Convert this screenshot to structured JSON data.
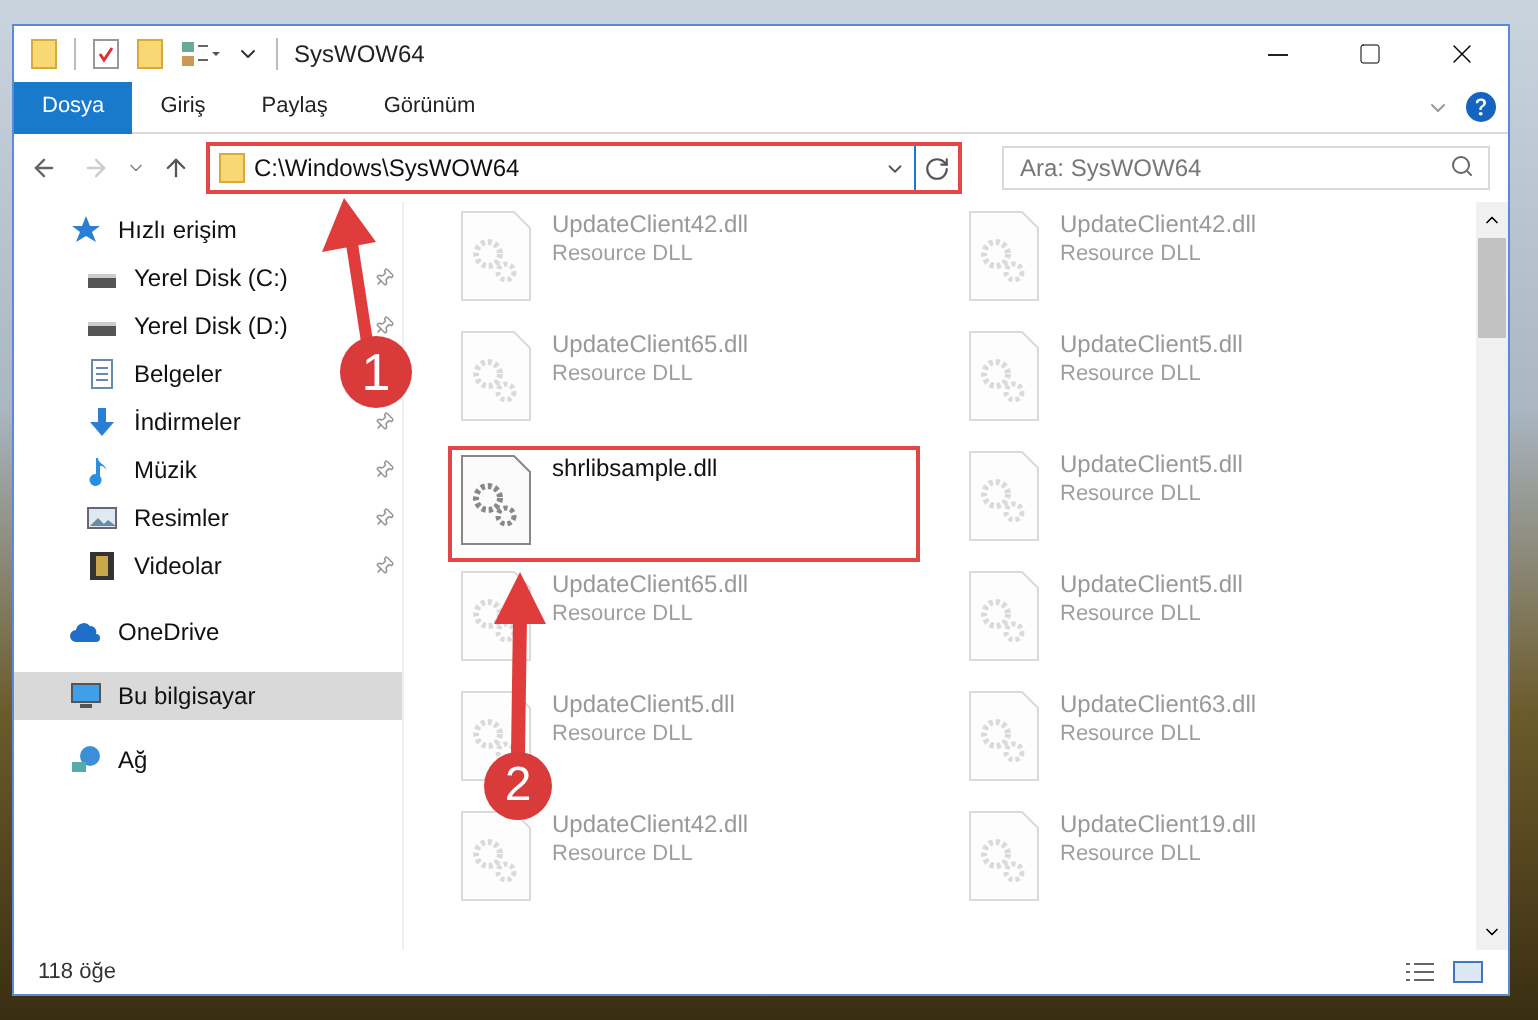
{
  "window": {
    "title": "SysWOW64"
  },
  "ribbon_tabs": [
    {
      "label": "Dosya",
      "selected": true
    },
    {
      "label": "Giriş",
      "selected": false
    },
    {
      "label": "Paylaş",
      "selected": false
    },
    {
      "label": "Görünüm",
      "selected": false
    }
  ],
  "address_bar": {
    "path": "C:\\Windows\\SysWOW64"
  },
  "search": {
    "placeholder": "Ara: SysWOW64"
  },
  "sidebar": {
    "items": [
      {
        "label": "Hızlı erişim",
        "kind": "star",
        "selected": false,
        "children": [
          {
            "label": "Yerel Disk (C:)",
            "kind": "drive",
            "pinned": true,
            "selected": false
          },
          {
            "label": "Yerel Disk (D:)",
            "kind": "drive",
            "pinned": true,
            "selected": false
          },
          {
            "label": "Belgeler",
            "kind": "document",
            "pinned": false,
            "selected": false
          },
          {
            "label": "İndirmeler",
            "kind": "download",
            "pinned": true,
            "selected": false
          },
          {
            "label": "Müzik",
            "kind": "music",
            "pinned": true,
            "selected": false
          },
          {
            "label": "Resimler",
            "kind": "picture",
            "pinned": true,
            "selected": false
          },
          {
            "label": "Videolar",
            "kind": "video",
            "pinned": true,
            "selected": false
          }
        ]
      },
      {
        "label": "OneDrive",
        "kind": "cloud",
        "selected": false
      },
      {
        "label": "Bu bilgisayar",
        "kind": "computer",
        "selected": true
      },
      {
        "label": "Ağ",
        "kind": "network",
        "selected": false
      }
    ]
  },
  "files": [
    {
      "name": "UpdateClient42.dll",
      "type": "Resource DLL",
      "faded": true
    },
    {
      "name": "UpdateClient42.dll",
      "type": "Resource DLL",
      "faded": true
    },
    {
      "name": "UpdateClient65.dll",
      "type": "Resource DLL",
      "faded": true
    },
    {
      "name": "UpdateClient5.dll",
      "type": "Resource DLL",
      "faded": true
    },
    {
      "name": "shrlibsample.dll",
      "faded": false
    },
    {
      "name": "UpdateClient5.dll",
      "type": "Resource DLL",
      "faded": true
    },
    {
      "name": "UpdateClient65.dll",
      "type": "Resource DLL",
      "faded": true
    },
    {
      "name": "UpdateClient5.dll",
      "type": "Resource DLL",
      "faded": true
    },
    {
      "name": "UpdateClient5.dll",
      "type": "Resource DLL",
      "faded": true
    },
    {
      "name": "UpdateClient63.dll",
      "type": "Resource DLL",
      "faded": true
    },
    {
      "name": "UpdateClient42.dll",
      "type": "Resource DLL",
      "faded": true
    },
    {
      "name": "UpdateClient19.dll",
      "type": "Resource DLL",
      "faded": true
    }
  ],
  "annotations": [
    {
      "number": "1"
    },
    {
      "number": "2"
    }
  ],
  "status_bar": {
    "count": "118 öğe"
  }
}
